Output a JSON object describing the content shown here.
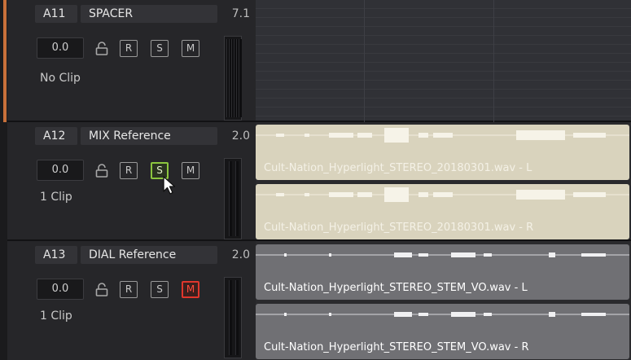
{
  "tracks": [
    {
      "id": "A11",
      "name": "SPACER",
      "channels": "7.1",
      "volume": "0.0",
      "buttons": {
        "r": "R",
        "s": "S",
        "m": "M"
      },
      "clip_count": "No Clip",
      "solo_active": false,
      "mute_active": false
    },
    {
      "id": "A12",
      "name": "MIX Reference",
      "channels": "2.0",
      "volume": "0.0",
      "buttons": {
        "r": "R",
        "s": "S",
        "m": "M"
      },
      "clip_count": "1 Clip",
      "solo_active": true,
      "mute_active": false,
      "clips": [
        "Cult-Nation_Hyperlight_STEREO_20180301.wav - L",
        "Cult-Nation_Hyperlight_STEREO_20180301.wav - R"
      ]
    },
    {
      "id": "A13",
      "name": "DIAL Reference",
      "channels": "2.0",
      "volume": "0.0",
      "buttons": {
        "r": "R",
        "s": "S",
        "m": "M"
      },
      "clip_count": "1 Clip",
      "solo_active": false,
      "mute_active": true,
      "clips": [
        "Cult-Nation_Hyperlight_STEREO_STEM_VO.wav - L",
        "Cult-Nation_Hyperlight_STEREO_STEM_VO.wav - R"
      ]
    }
  ],
  "colors": {
    "track_color_a11": "#c8703a",
    "mix_clip": "#d9d3bd",
    "dial_clip": "#707074",
    "solo_active": "#8cc63e",
    "mute_active": "#e0362c"
  },
  "icons": {
    "lock": "lock-icon",
    "cursor": "mouse-pointer-icon"
  }
}
